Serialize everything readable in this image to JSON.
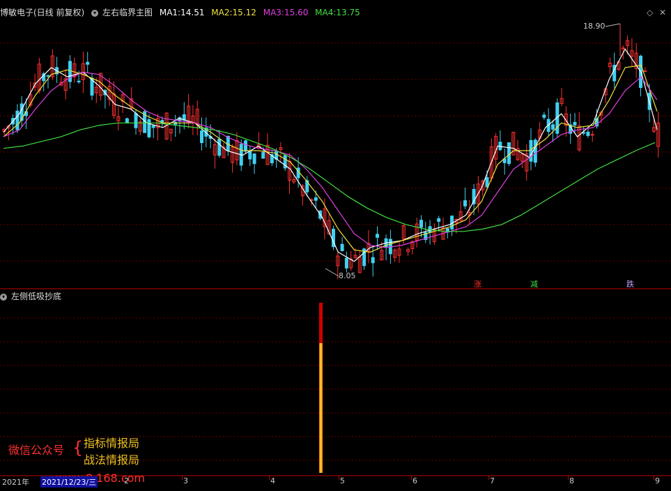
{
  "top_header": {
    "stock": "博敏电子(日线 前复权)",
    "indicator": "左右临界主图",
    "ma": [
      {
        "label": "MA1:",
        "value": "14.51",
        "color": "#ffffff"
      },
      {
        "label": "MA2:",
        "value": "15.12",
        "color": "#f0e040"
      },
      {
        "label": "MA3:",
        "value": "15.60",
        "color": "#e040e0"
      },
      {
        "label": "MA4:",
        "value": "13.75",
        "color": "#40e040"
      }
    ]
  },
  "sub_header": {
    "indicator": "左侧低吸抄底"
  },
  "annotations": {
    "high_label": "18.90",
    "low_label": "8.05",
    "sig_zhang": "涨",
    "sig_jian": "减",
    "sig_die": "跌"
  },
  "x_axis": {
    "ticks": [
      "2",
      "3",
      "4",
      "5",
      "6",
      "7",
      "8",
      "9"
    ],
    "date": "2021/12/23/三",
    "year": "2021年"
  },
  "watermark": {
    "left": "微信公众号",
    "brace": "{",
    "line1": "指标情报局",
    "line2": "战法情报局",
    "site": "www.8  168.com"
  },
  "chart_data": {
    "type": "line",
    "series": [
      {
        "name": "MA1",
        "color": "#ffffff",
        "values": [
          14.2,
          15.0,
          16.3,
          17.0,
          16.6,
          16.8,
          16.2,
          15.4,
          15.2,
          14.6,
          14.4,
          14.8,
          14.6,
          14.0,
          13.4,
          13.2,
          13.6,
          13.1,
          12.6,
          11.5,
          10.5,
          9.0,
          8.6,
          9.2,
          9.4,
          9.5,
          9.8,
          10.0,
          10.2,
          10.6,
          11.8,
          13.6,
          13.5,
          13.1,
          14.4,
          15.0,
          14.0,
          14.6,
          16.5,
          17.8,
          16.8,
          14.3
        ]
      },
      {
        "name": "MA2",
        "color": "#f0e040",
        "values": [
          14.0,
          14.6,
          15.8,
          16.7,
          16.9,
          16.7,
          16.4,
          15.8,
          15.3,
          14.9,
          14.6,
          14.6,
          14.6,
          14.2,
          13.7,
          13.4,
          13.4,
          13.3,
          12.9,
          12.1,
          11.2,
          10.0,
          9.1,
          9.0,
          9.3,
          9.5,
          9.7,
          9.9,
          10.1,
          10.4,
          11.2,
          12.8,
          13.4,
          13.4,
          13.9,
          14.6,
          14.4,
          14.5,
          15.6,
          17.0,
          17.1,
          15.1
        ]
      },
      {
        "name": "MA3",
        "color": "#e040e0",
        "values": [
          14.0,
          14.3,
          15.2,
          16.0,
          16.5,
          16.8,
          16.7,
          16.2,
          15.6,
          15.1,
          14.8,
          14.7,
          14.6,
          14.4,
          14.0,
          13.7,
          13.5,
          13.4,
          13.2,
          12.6,
          11.8,
          10.8,
          9.8,
          9.3,
          9.2,
          9.3,
          9.5,
          9.7,
          9.9,
          10.1,
          10.6,
          11.6,
          12.6,
          13.1,
          13.6,
          14.1,
          14.3,
          14.4,
          15.0,
          16.0,
          16.6,
          15.6
        ]
      },
      {
        "name": "MA4",
        "color": "#40e040",
        "values": [
          13.5,
          13.6,
          13.8,
          14.0,
          14.3,
          14.5,
          14.6,
          14.6,
          14.6,
          14.5,
          14.4,
          14.3,
          14.1,
          13.8,
          13.5,
          13.1,
          12.6,
          12.0,
          11.4,
          10.9,
          10.5,
          10.2,
          10.0,
          9.9,
          9.9,
          10.0,
          10.2,
          10.6,
          11.1,
          11.6,
          12.1,
          12.6,
          13.0,
          13.4,
          13.75
        ]
      }
    ],
    "high": 18.9,
    "low": 8.05,
    "sub_signal": {
      "label": "左侧低吸抄底",
      "values": [
        1
      ]
    }
  }
}
